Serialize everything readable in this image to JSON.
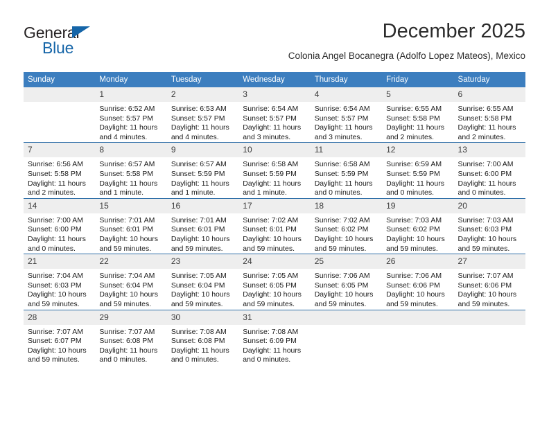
{
  "brand": {
    "name_part1": "General",
    "name_part2": "Blue",
    "accent_color": "#1565a8"
  },
  "header": {
    "title": "December 2025",
    "subtitle": "Colonia Angel Bocanegra (Adolfo Lopez Mateos), Mexico",
    "header_bg_color": "#3c7ebf",
    "row_separator_color": "#2f6fa8",
    "daynum_bg_color": "#eeeeee"
  },
  "weekday_headers": [
    "Sunday",
    "Monday",
    "Tuesday",
    "Wednesday",
    "Thursday",
    "Friday",
    "Saturday"
  ],
  "labels": {
    "sunrise_prefix": "Sunrise:",
    "sunset_prefix": "Sunset:",
    "daylight_prefix": "Daylight:"
  },
  "weeks": [
    [
      {
        "day": "",
        "sunrise": "",
        "sunset": "",
        "daylight_line1": "",
        "daylight_line2": ""
      },
      {
        "day": "1",
        "sunrise": "Sunrise: 6:52 AM",
        "sunset": "Sunset: 5:57 PM",
        "daylight_line1": "Daylight: 11 hours",
        "daylight_line2": "and 4 minutes."
      },
      {
        "day": "2",
        "sunrise": "Sunrise: 6:53 AM",
        "sunset": "Sunset: 5:57 PM",
        "daylight_line1": "Daylight: 11 hours",
        "daylight_line2": "and 4 minutes."
      },
      {
        "day": "3",
        "sunrise": "Sunrise: 6:54 AM",
        "sunset": "Sunset: 5:57 PM",
        "daylight_line1": "Daylight: 11 hours",
        "daylight_line2": "and 3 minutes."
      },
      {
        "day": "4",
        "sunrise": "Sunrise: 6:54 AM",
        "sunset": "Sunset: 5:57 PM",
        "daylight_line1": "Daylight: 11 hours",
        "daylight_line2": "and 3 minutes."
      },
      {
        "day": "5",
        "sunrise": "Sunrise: 6:55 AM",
        "sunset": "Sunset: 5:58 PM",
        "daylight_line1": "Daylight: 11 hours",
        "daylight_line2": "and 2 minutes."
      },
      {
        "day": "6",
        "sunrise": "Sunrise: 6:55 AM",
        "sunset": "Sunset: 5:58 PM",
        "daylight_line1": "Daylight: 11 hours",
        "daylight_line2": "and 2 minutes."
      }
    ],
    [
      {
        "day": "7",
        "sunrise": "Sunrise: 6:56 AM",
        "sunset": "Sunset: 5:58 PM",
        "daylight_line1": "Daylight: 11 hours",
        "daylight_line2": "and 2 minutes."
      },
      {
        "day": "8",
        "sunrise": "Sunrise: 6:57 AM",
        "sunset": "Sunset: 5:58 PM",
        "daylight_line1": "Daylight: 11 hours",
        "daylight_line2": "and 1 minute."
      },
      {
        "day": "9",
        "sunrise": "Sunrise: 6:57 AM",
        "sunset": "Sunset: 5:59 PM",
        "daylight_line1": "Daylight: 11 hours",
        "daylight_line2": "and 1 minute."
      },
      {
        "day": "10",
        "sunrise": "Sunrise: 6:58 AM",
        "sunset": "Sunset: 5:59 PM",
        "daylight_line1": "Daylight: 11 hours",
        "daylight_line2": "and 1 minute."
      },
      {
        "day": "11",
        "sunrise": "Sunrise: 6:58 AM",
        "sunset": "Sunset: 5:59 PM",
        "daylight_line1": "Daylight: 11 hours",
        "daylight_line2": "and 0 minutes."
      },
      {
        "day": "12",
        "sunrise": "Sunrise: 6:59 AM",
        "sunset": "Sunset: 5:59 PM",
        "daylight_line1": "Daylight: 11 hours",
        "daylight_line2": "and 0 minutes."
      },
      {
        "day": "13",
        "sunrise": "Sunrise: 7:00 AM",
        "sunset": "Sunset: 6:00 PM",
        "daylight_line1": "Daylight: 11 hours",
        "daylight_line2": "and 0 minutes."
      }
    ],
    [
      {
        "day": "14",
        "sunrise": "Sunrise: 7:00 AM",
        "sunset": "Sunset: 6:00 PM",
        "daylight_line1": "Daylight: 11 hours",
        "daylight_line2": "and 0 minutes."
      },
      {
        "day": "15",
        "sunrise": "Sunrise: 7:01 AM",
        "sunset": "Sunset: 6:01 PM",
        "daylight_line1": "Daylight: 10 hours",
        "daylight_line2": "and 59 minutes."
      },
      {
        "day": "16",
        "sunrise": "Sunrise: 7:01 AM",
        "sunset": "Sunset: 6:01 PM",
        "daylight_line1": "Daylight: 10 hours",
        "daylight_line2": "and 59 minutes."
      },
      {
        "day": "17",
        "sunrise": "Sunrise: 7:02 AM",
        "sunset": "Sunset: 6:01 PM",
        "daylight_line1": "Daylight: 10 hours",
        "daylight_line2": "and 59 minutes."
      },
      {
        "day": "18",
        "sunrise": "Sunrise: 7:02 AM",
        "sunset": "Sunset: 6:02 PM",
        "daylight_line1": "Daylight: 10 hours",
        "daylight_line2": "and 59 minutes."
      },
      {
        "day": "19",
        "sunrise": "Sunrise: 7:03 AM",
        "sunset": "Sunset: 6:02 PM",
        "daylight_line1": "Daylight: 10 hours",
        "daylight_line2": "and 59 minutes."
      },
      {
        "day": "20",
        "sunrise": "Sunrise: 7:03 AM",
        "sunset": "Sunset: 6:03 PM",
        "daylight_line1": "Daylight: 10 hours",
        "daylight_line2": "and 59 minutes."
      }
    ],
    [
      {
        "day": "21",
        "sunrise": "Sunrise: 7:04 AM",
        "sunset": "Sunset: 6:03 PM",
        "daylight_line1": "Daylight: 10 hours",
        "daylight_line2": "and 59 minutes."
      },
      {
        "day": "22",
        "sunrise": "Sunrise: 7:04 AM",
        "sunset": "Sunset: 6:04 PM",
        "daylight_line1": "Daylight: 10 hours",
        "daylight_line2": "and 59 minutes."
      },
      {
        "day": "23",
        "sunrise": "Sunrise: 7:05 AM",
        "sunset": "Sunset: 6:04 PM",
        "daylight_line1": "Daylight: 10 hours",
        "daylight_line2": "and 59 minutes."
      },
      {
        "day": "24",
        "sunrise": "Sunrise: 7:05 AM",
        "sunset": "Sunset: 6:05 PM",
        "daylight_line1": "Daylight: 10 hours",
        "daylight_line2": "and 59 minutes."
      },
      {
        "day": "25",
        "sunrise": "Sunrise: 7:06 AM",
        "sunset": "Sunset: 6:05 PM",
        "daylight_line1": "Daylight: 10 hours",
        "daylight_line2": "and 59 minutes."
      },
      {
        "day": "26",
        "sunrise": "Sunrise: 7:06 AM",
        "sunset": "Sunset: 6:06 PM",
        "daylight_line1": "Daylight: 10 hours",
        "daylight_line2": "and 59 minutes."
      },
      {
        "day": "27",
        "sunrise": "Sunrise: 7:07 AM",
        "sunset": "Sunset: 6:06 PM",
        "daylight_line1": "Daylight: 10 hours",
        "daylight_line2": "and 59 minutes."
      }
    ],
    [
      {
        "day": "28",
        "sunrise": "Sunrise: 7:07 AM",
        "sunset": "Sunset: 6:07 PM",
        "daylight_line1": "Daylight: 10 hours",
        "daylight_line2": "and 59 minutes."
      },
      {
        "day": "29",
        "sunrise": "Sunrise: 7:07 AM",
        "sunset": "Sunset: 6:08 PM",
        "daylight_line1": "Daylight: 11 hours",
        "daylight_line2": "and 0 minutes."
      },
      {
        "day": "30",
        "sunrise": "Sunrise: 7:08 AM",
        "sunset": "Sunset: 6:08 PM",
        "daylight_line1": "Daylight: 11 hours",
        "daylight_line2": "and 0 minutes."
      },
      {
        "day": "31",
        "sunrise": "Sunrise: 7:08 AM",
        "sunset": "Sunset: 6:09 PM",
        "daylight_line1": "Daylight: 11 hours",
        "daylight_line2": "and 0 minutes."
      },
      {
        "day": "",
        "sunrise": "",
        "sunset": "",
        "daylight_line1": "",
        "daylight_line2": ""
      },
      {
        "day": "",
        "sunrise": "",
        "sunset": "",
        "daylight_line1": "",
        "daylight_line2": ""
      },
      {
        "day": "",
        "sunrise": "",
        "sunset": "",
        "daylight_line1": "",
        "daylight_line2": ""
      }
    ]
  ]
}
